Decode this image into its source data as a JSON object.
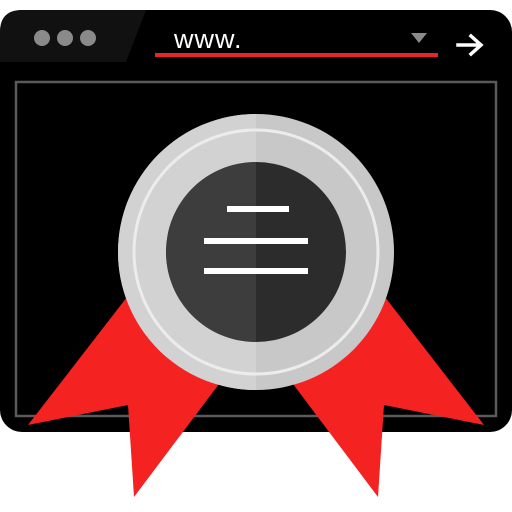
{
  "browser": {
    "address_bar": {
      "text": "www."
    },
    "icons": {
      "window_controls": "three-dots-icon",
      "dropdown": "triangle-down-icon",
      "go": "arrow-right-icon"
    }
  },
  "content": {
    "badge": {
      "icon": "award-ribbon-badge-icon",
      "colors": {
        "medal_light": "#c8c8c8",
        "medal_dark": "#3c3c3c",
        "ribbon": "#f52222"
      }
    }
  },
  "colors": {
    "frame": "#000000",
    "accent": "#e8242b",
    "background": "#ffffff"
  }
}
